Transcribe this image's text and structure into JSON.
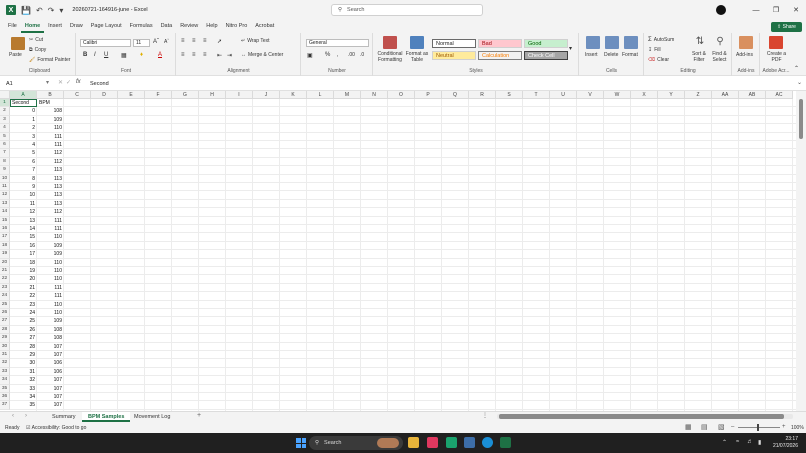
{
  "app": {
    "file_title": "20260721-164916-june",
    "app_name": "Excel",
    "search_placeholder": "Search",
    "share_label": "Share"
  },
  "menu": [
    "File",
    "Home",
    "Insert",
    "Draw",
    "Page Layout",
    "Formulas",
    "Data",
    "Review",
    "Help",
    "Nitro Pro",
    "Acrobat"
  ],
  "ribbon": {
    "clipboard": {
      "label": "Clipboard",
      "paste": "Paste",
      "cut": "Cut",
      "copy": "Copy",
      "format_painter": "Format Painter"
    },
    "font": {
      "label": "Font",
      "font_name": "Calibri",
      "font_size": "11"
    },
    "alignment": {
      "label": "Alignment",
      "wrap_text": "Wrap Text",
      "merge_center": "Merge & Center"
    },
    "number": {
      "label": "Number",
      "format": "General"
    },
    "styles": {
      "label": "Styles",
      "conditional": "Conditional Formatting",
      "format_table": "Format as Table",
      "normal": "Normal",
      "bad": "Bad",
      "good": "Good",
      "neutral": "Neutral",
      "calculation": "Calculation",
      "check_cell": "Check Cell"
    },
    "cells": {
      "label": "Cells",
      "insert": "Insert",
      "delete": "Delete",
      "format": "Format"
    },
    "editing": {
      "label": "Editing",
      "autosum": "AutoSum",
      "fill": "Fill",
      "clear": "Clear",
      "sort_filter": "Sort & Filter",
      "find_select": "Find & Select"
    },
    "addins": {
      "label": "Add-ins",
      "addins": "Add-ins"
    },
    "adobe": {
      "label": "Adobe Acr...",
      "create_pdf": "Create a PDF"
    }
  },
  "formula_bar": {
    "name_box": "A1",
    "fx": "fx",
    "content": "Second"
  },
  "columns": [
    "A",
    "B",
    "C",
    "D",
    "E",
    "F",
    "G",
    "H",
    "I",
    "J",
    "K",
    "L",
    "M",
    "N",
    "O",
    "P",
    "Q",
    "R",
    "S",
    "T",
    "U",
    "V",
    "W",
    "X",
    "Y",
    "Z",
    "AA",
    "AB",
    "AC"
  ],
  "rows": [
    "1",
    "2",
    "3",
    "4",
    "5",
    "6",
    "7",
    "8",
    "9",
    "10",
    "11",
    "12",
    "13",
    "14",
    "15",
    "16",
    "17",
    "18",
    "19",
    "20",
    "21",
    "22",
    "23",
    "24",
    "25",
    "26",
    "27",
    "28",
    "29",
    "30",
    "31",
    "32",
    "33",
    "34",
    "35",
    "36",
    "37"
  ],
  "table": {
    "headers": [
      "Second",
      "BPM"
    ],
    "data": [
      [
        "0",
        "108"
      ],
      [
        "1",
        "109"
      ],
      [
        "2",
        "110"
      ],
      [
        "3",
        "111"
      ],
      [
        "4",
        "111"
      ],
      [
        "5",
        "112"
      ],
      [
        "6",
        "112"
      ],
      [
        "7",
        "113"
      ],
      [
        "8",
        "113"
      ],
      [
        "9",
        "113"
      ],
      [
        "10",
        "113"
      ],
      [
        "11",
        "113"
      ],
      [
        "12",
        "112"
      ],
      [
        "13",
        "111"
      ],
      [
        "14",
        "111"
      ],
      [
        "15",
        "110"
      ],
      [
        "16",
        "109"
      ],
      [
        "17",
        "109"
      ],
      [
        "18",
        "110"
      ],
      [
        "19",
        "110"
      ],
      [
        "20",
        "110"
      ],
      [
        "21",
        "111"
      ],
      [
        "22",
        "111"
      ],
      [
        "23",
        "110"
      ],
      [
        "24",
        "110"
      ],
      [
        "25",
        "109"
      ],
      [
        "26",
        "108"
      ],
      [
        "27",
        "108"
      ],
      [
        "28",
        "107"
      ],
      [
        "29",
        "107"
      ],
      [
        "30",
        "106"
      ],
      [
        "31",
        "106"
      ],
      [
        "32",
        "107"
      ],
      [
        "33",
        "107"
      ],
      [
        "34",
        "107"
      ],
      [
        "35",
        "107"
      ]
    ]
  },
  "sheet_tabs": [
    "Summary",
    "BPM Samples",
    "Movement Log"
  ],
  "active_tab": "BPM Samples",
  "status": {
    "ready": "Ready",
    "accessibility": "Accessibility: Good to go",
    "zoom": "100%"
  },
  "taskbar": {
    "search": "Search",
    "time": "23:17",
    "date": "21/07/2026"
  }
}
